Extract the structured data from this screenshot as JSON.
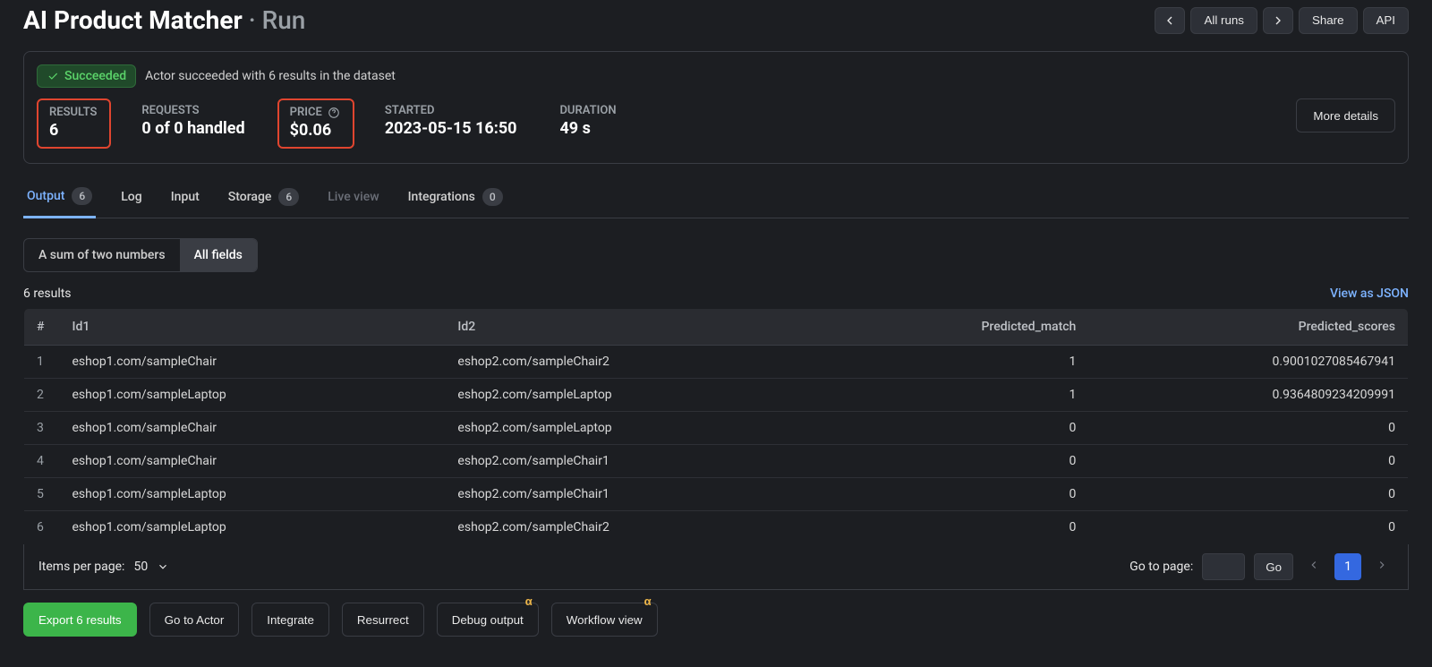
{
  "title_main": "AI Product Matcher",
  "title_sub": " · Run",
  "header_buttons": {
    "all_runs": "All runs",
    "share": "Share",
    "api": "API"
  },
  "status": {
    "label": "Succeeded",
    "message": "Actor succeeded with 6 results in the dataset"
  },
  "stats": {
    "results_label": "RESULTS",
    "results_value": "6",
    "requests_label": "REQUESTS",
    "requests_value": "0 of 0 handled",
    "price_label": "PRICE",
    "price_value": "$0.06",
    "started_label": "STARTED",
    "started_value": "2023-05-15 16:50",
    "duration_label": "DURATION",
    "duration_value": "49 s",
    "more_details": "More details"
  },
  "tabs": {
    "output": "Output",
    "output_badge": "6",
    "log": "Log",
    "input": "Input",
    "storage": "Storage",
    "storage_badge": "6",
    "live": "Live view",
    "integrations": "Integrations",
    "integrations_badge": "0"
  },
  "segments": {
    "sum": "A sum of two numbers",
    "all": "All fields"
  },
  "results_count": "6 results",
  "view_json": "View as JSON",
  "columns": [
    "#",
    "Id1",
    "Id2",
    "Predicted_match",
    "Predicted_scores"
  ],
  "rows": [
    {
      "n": "1",
      "id1": "eshop1.com/sampleChair",
      "id2": "eshop2.com/sampleChair2",
      "match": "1",
      "score": "0.9001027085467941"
    },
    {
      "n": "2",
      "id1": "eshop1.com/sampleLaptop",
      "id2": "eshop2.com/sampleLaptop",
      "match": "1",
      "score": "0.9364809234209991"
    },
    {
      "n": "3",
      "id1": "eshop1.com/sampleChair",
      "id2": "eshop2.com/sampleLaptop",
      "match": "0",
      "score": "0"
    },
    {
      "n": "4",
      "id1": "eshop1.com/sampleChair",
      "id2": "eshop2.com/sampleChair1",
      "match": "0",
      "score": "0"
    },
    {
      "n": "5",
      "id1": "eshop1.com/sampleLaptop",
      "id2": "eshop2.com/sampleChair1",
      "match": "0",
      "score": "0"
    },
    {
      "n": "6",
      "id1": "eshop1.com/sampleLaptop",
      "id2": "eshop2.com/sampleChair2",
      "match": "0",
      "score": "0"
    }
  ],
  "pager": {
    "items_label": "Items per page:",
    "items_value": "50",
    "goto_label": "Go to page:",
    "go_btn": "Go",
    "current_page": "1"
  },
  "actions": {
    "export": "Export 6 results",
    "goto_actor": "Go to Actor",
    "integrate": "Integrate",
    "resurrect": "Resurrect",
    "debug": "Debug output",
    "workflow": "Workflow view",
    "alpha": "α"
  }
}
